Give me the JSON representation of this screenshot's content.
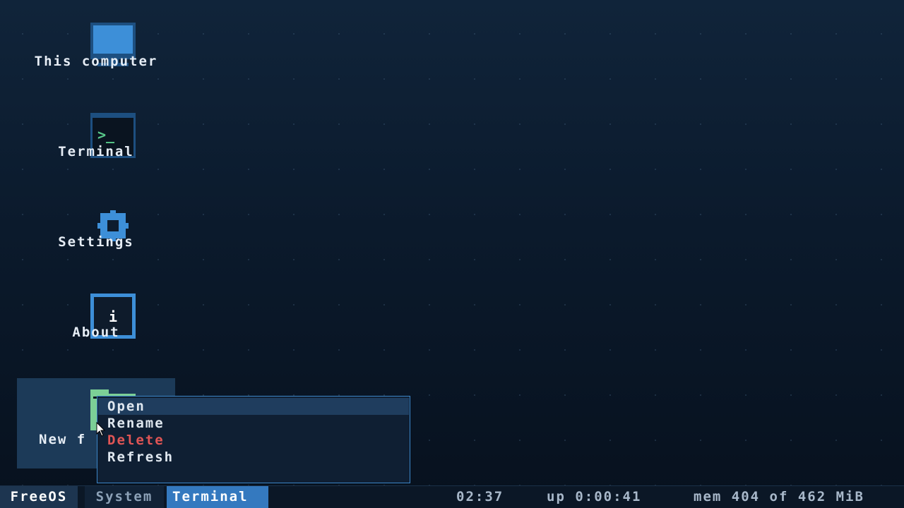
{
  "desktop": {
    "icons": [
      {
        "label": "This computer",
        "icon": "monitor-icon"
      },
      {
        "label": "Terminal",
        "icon": "terminal-icon",
        "glyph": ">_"
      },
      {
        "label": "Settings",
        "icon": "gear-icon"
      },
      {
        "label": "About",
        "icon": "info-icon",
        "glyph": "i"
      },
      {
        "label": "New f",
        "icon": "folder-icon",
        "selected": true
      }
    ]
  },
  "context_menu": {
    "items": [
      {
        "label": "Open",
        "state": "hover"
      },
      {
        "label": "Rename"
      },
      {
        "label": "Delete",
        "style": "danger"
      },
      {
        "label": "Refresh"
      }
    ]
  },
  "taskbar": {
    "start_label": "FreeOS",
    "tasks": [
      {
        "label": "System",
        "active": false
      },
      {
        "label": "Terminal",
        "active": true
      }
    ],
    "clock": "02:37",
    "uptime": "up 0:00:41",
    "memory": "mem 404 of 462 MiB"
  },
  "colors": {
    "accent": "#3479bf",
    "icon_blue": "#3d8fd8",
    "folder_green": "#7ccf96",
    "terminal_green": "#58c98a",
    "danger": "#e05555",
    "selection": "#1c3a58"
  }
}
